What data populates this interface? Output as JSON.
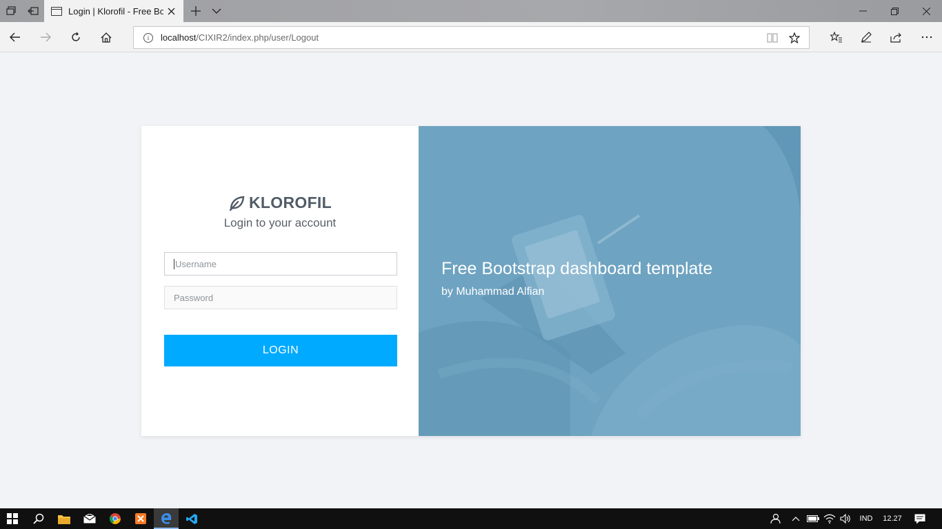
{
  "browser": {
    "tab_title": "Login | Klorofil - Free Bootstrap",
    "url_host": "localhost",
    "url_path": "/CIXIR2/index.php/user/Logout"
  },
  "login": {
    "brand": "KLOROFIL",
    "subtitle": "Login to your account",
    "username_placeholder": "Username",
    "password_placeholder": "Password",
    "login_button": "LOGIN"
  },
  "promo": {
    "headline": "Free Bootstrap dashboard template",
    "byline": "by Muhammad Alfian"
  },
  "taskbar": {
    "language": "IND",
    "time": "12.27"
  },
  "colors": {
    "accent": "#00aaff",
    "brand_text": "#525c67",
    "promo_overlay": "#6da2c0"
  }
}
